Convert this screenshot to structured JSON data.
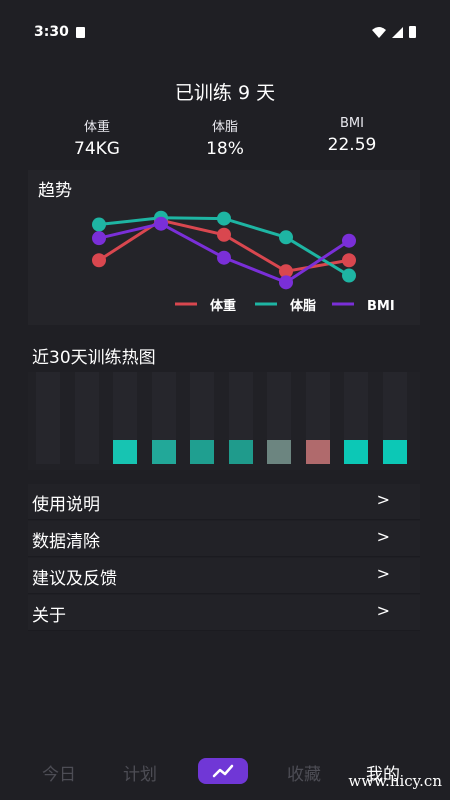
{
  "status": {
    "time": "3:30"
  },
  "header": {
    "title": "已训练 9 天"
  },
  "stats": [
    {
      "label": "体重",
      "value": "74KG"
    },
    {
      "label": "体脂",
      "value": "18%"
    },
    {
      "label": "BMI",
      "value": "22.59"
    }
  ],
  "trend": {
    "title": "趋势",
    "chart_data": {
      "type": "line",
      "x": [
        1,
        2,
        3,
        4,
        5
      ],
      "series": [
        {
          "name": "体重",
          "color": "#d9474f",
          "values": [
            0.35,
            0.82,
            0.65,
            0.22,
            0.35
          ]
        },
        {
          "name": "体脂",
          "color": "#1eb5a3",
          "values": [
            0.77,
            0.85,
            0.84,
            0.62,
            0.17
          ]
        },
        {
          "name": "BMI",
          "color": "#7a2fd8",
          "values": [
            0.61,
            0.78,
            0.38,
            0.09,
            0.58
          ]
        }
      ],
      "legend": "bottom-right"
    }
  },
  "heatmap": {
    "title": "近30天训练热图",
    "visible_cells": [
      "#17c4b2",
      "#22a899",
      "#1f9f90",
      "#1f9b8c",
      "#6c8580",
      "#b06a6c",
      "#0cc8b6",
      "#0cc8b6"
    ]
  },
  "menu": [
    {
      "label": "使用说明"
    },
    {
      "label": "数据清除"
    },
    {
      "label": "建议及反馈"
    },
    {
      "label": "关于"
    }
  ],
  "tabs": [
    {
      "label": "今日"
    },
    {
      "label": "计划"
    },
    {
      "label": "收藏"
    },
    {
      "label": "我的"
    }
  ],
  "watermark": "www.hicy.cn"
}
